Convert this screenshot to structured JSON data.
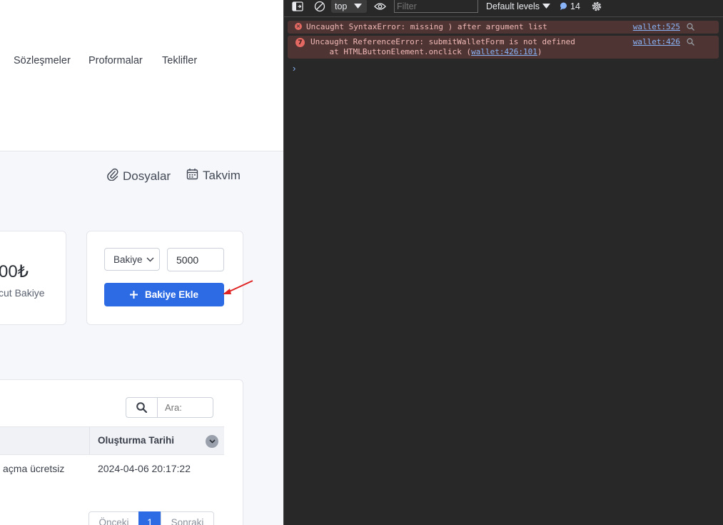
{
  "page": {
    "nav": [
      "Sözleşmeler",
      "Proformalar",
      "Teklifler"
    ],
    "toolbar": {
      "files_label": "Dosyalar",
      "calendar_label": "Takvim"
    },
    "balance_card": {
      "value": "00₺",
      "label": "cut Bakiye"
    },
    "wallet_form": {
      "type_selected": "Bakiye",
      "amount_value": "5000",
      "add_button_label": "Bakiye Ekle"
    },
    "table": {
      "search_placeholder": "Ara:",
      "header": "Oluşturma Tarihi",
      "row": {
        "description": "açma ücretsiz",
        "created_at": "2024-04-06 20:17:22"
      },
      "pagination": {
        "prev": "Önceki",
        "current": "1",
        "next": "Sonraki"
      }
    }
  },
  "devtools": {
    "context": "top",
    "filter_placeholder": "Filter",
    "levels": "Default levels",
    "issues_count": "14",
    "messages": [
      {
        "text": "Uncaught SyntaxError: missing ) after argument list",
        "source": "wallet:525"
      },
      {
        "count": "7",
        "text": "Uncaught ReferenceError: submitWalletForm is not defined",
        "stack_prefix": "    at HTMLButtonElement.onclick (",
        "stack_link": "wallet:426:101",
        "stack_suffix": ")",
        "source": "wallet:426"
      }
    ],
    "prompt": "›"
  },
  "colors": {
    "accent": "#2d6be4",
    "annotation_arrow": "#e02424",
    "error_bg": "#4e3534",
    "devtools_bg": "#282828"
  }
}
